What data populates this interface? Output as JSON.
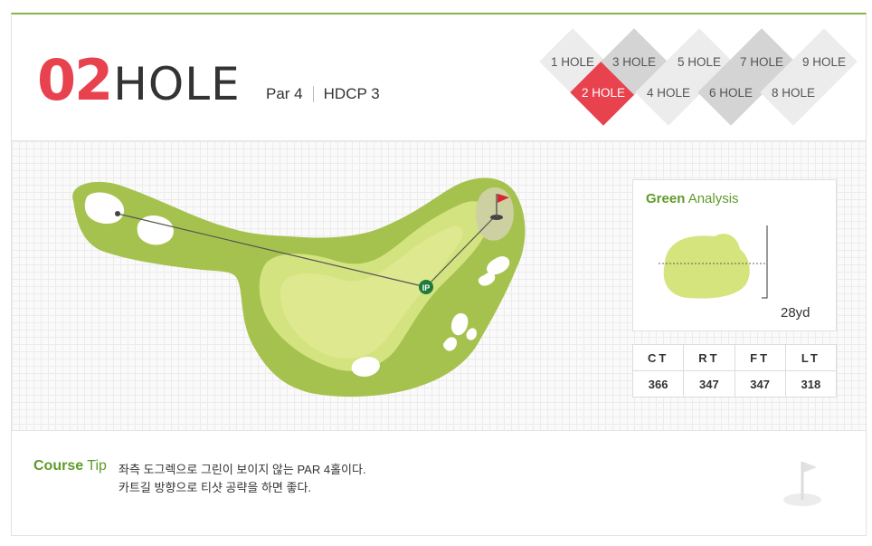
{
  "header": {
    "hole_number": "02",
    "hole_word": "HOLE",
    "par": "Par 4",
    "hdcp": "HDCP 3"
  },
  "hole_nav": {
    "items": [
      {
        "label": "1 HOLE",
        "state": "light"
      },
      {
        "label": "2 HOLE",
        "state": "active"
      },
      {
        "label": "3 HOLE",
        "state": "dark"
      },
      {
        "label": "4 HOLE",
        "state": "light"
      },
      {
        "label": "5 HOLE",
        "state": "light"
      },
      {
        "label": "6 HOLE",
        "state": "dark"
      },
      {
        "label": "7 HOLE",
        "state": "dark"
      },
      {
        "label": "8 HOLE",
        "state": "light"
      },
      {
        "label": "9 HOLE",
        "state": "light"
      }
    ]
  },
  "map": {
    "ip_label": "IP",
    "colors": {
      "rough": "#a6c24e",
      "fairway": "#d3e37f",
      "bunker": "#ffffff",
      "green": "#cdd0a0",
      "flag": "#d9262e"
    }
  },
  "green_analysis": {
    "title_bold": "Green",
    "title_rest": "Analysis",
    "size": "28yd",
    "color": "#d6e47e"
  },
  "tee_table": {
    "headers": [
      "CT",
      "RT",
      "FT",
      "LT"
    ],
    "values": [
      "366",
      "347",
      "347",
      "318"
    ]
  },
  "course_tip": {
    "title_bold": "Course",
    "title_rest": "Tip",
    "line1": "좌측 도그렉으로 그린이 보이지 않는 PAR 4홀이다.",
    "line2": "카트길 방향으로 티샷 공략을 하면 좋다."
  },
  "brand": {
    "accent_green": "#8ab34a",
    "accent_red": "#e8424e"
  }
}
